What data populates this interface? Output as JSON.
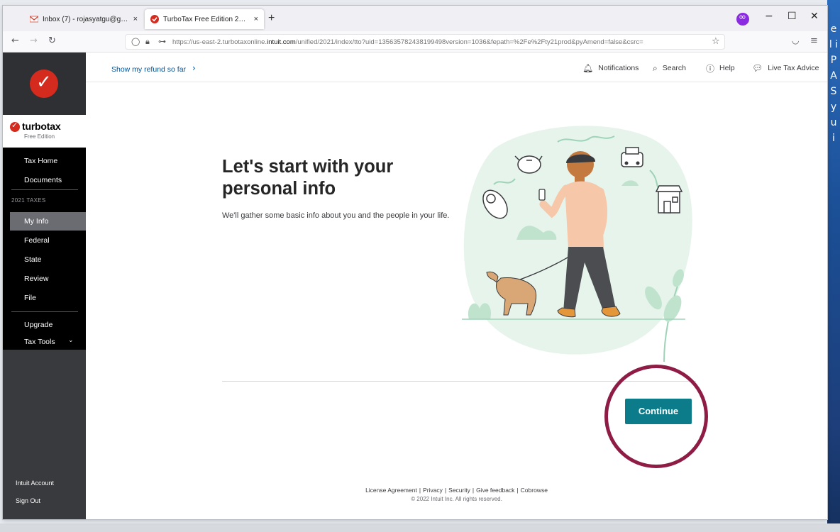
{
  "browser": {
    "tabs": [
      {
        "favicon": "gmail-icon",
        "title": "Inbox (7) - rojasyatgu@gmail.c",
        "close": "×"
      },
      {
        "favicon": "turbotax-icon",
        "title": "TurboTax Free Edition 2021",
        "close": "×"
      }
    ],
    "new_tab": "+",
    "url_host_prefix": "https://us-east-2.turbotaxonline.",
    "url_host_domain": "intuit.com",
    "url_path": "/unified/2021/index/tto?uid=135635782438199498version=1036&fepath=%2Fe%2Fty21prod&pyAmend=false&csrc=",
    "window_controls": {
      "minimize": "−",
      "maximize": "☐",
      "close": "✕"
    }
  },
  "brand": {
    "name": "turbotax",
    "edition": "Free Edition"
  },
  "sidebar": {
    "top_items": [
      {
        "label": "Tax Home"
      },
      {
        "label": "Documents"
      }
    ],
    "section_label": "2021 TAXES",
    "tax_items": [
      {
        "label": "My Info",
        "active": true
      },
      {
        "label": "Federal"
      },
      {
        "label": "State"
      },
      {
        "label": "Review"
      },
      {
        "label": "File"
      }
    ],
    "extra_items": [
      {
        "label": "Upgrade"
      },
      {
        "label": "Tax Tools",
        "chevron": "⌄"
      }
    ],
    "footer_items": [
      {
        "label": "Intuit Account"
      },
      {
        "label": "Sign Out"
      }
    ]
  },
  "topbar": {
    "refund_link": "Show my refund so far",
    "refund_chevron": "›",
    "notifications": "Notifications",
    "search": "Search",
    "help": "Help",
    "live_tax_advice": "Live Tax Advice"
  },
  "main": {
    "headline": "Let's start with your personal info",
    "subtext": "We'll gather some basic info about you and the people in your life.",
    "continue_label": "Continue"
  },
  "footer": {
    "links": [
      "License Agreement",
      "Privacy",
      "Security",
      "Give feedback",
      "Cobrowse"
    ],
    "copyright": "© 2022 Intuit Inc. All rights reserved."
  },
  "desktop": {
    "right_edge_text": "e l i P A S y u i"
  },
  "colors": {
    "brand_red": "#d52b1e",
    "continue_teal": "#0d7c8a",
    "highlight_ring": "#8e1c45",
    "sidebar_dark": "#393a3d",
    "link_blue": "#055393"
  }
}
